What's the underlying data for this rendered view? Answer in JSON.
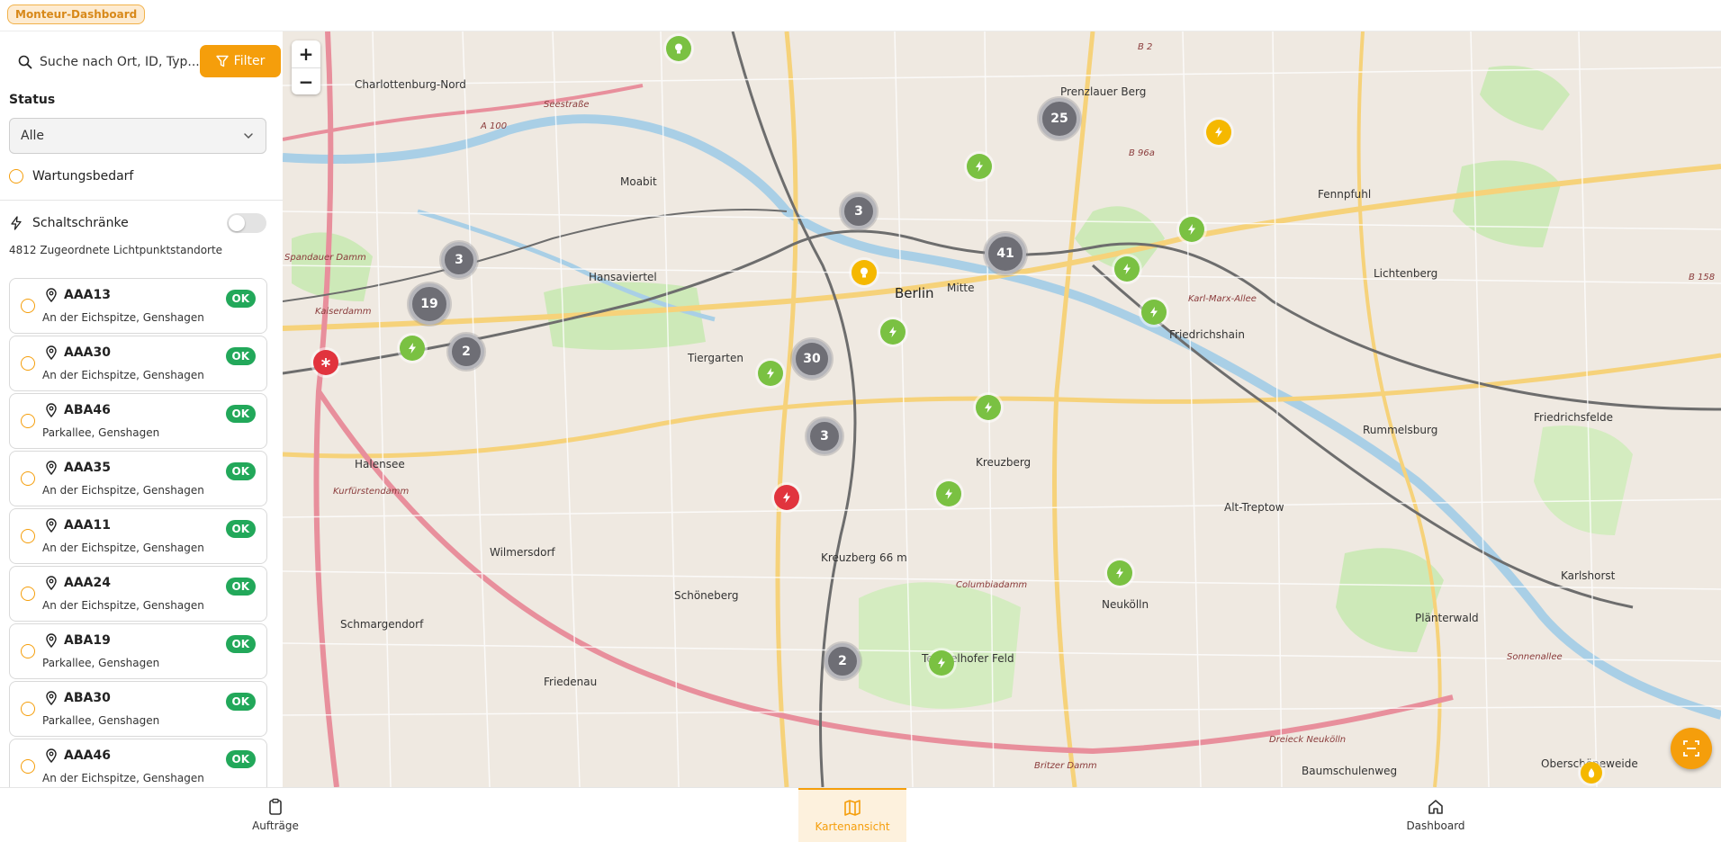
{
  "header": {
    "app_badge": "Monteur-Dashboard"
  },
  "sidebar": {
    "search_placeholder": "Suche nach Ort, ID, Typ...",
    "filter_label": "Filter",
    "status_label": "Status",
    "status_value": "Alle",
    "wartung_label": "Wartungsbedarf",
    "schalt_label": "Schaltschränke",
    "count_text": "4812 Zugeordnete Lichtpunktstandorte",
    "items": [
      {
        "id": "AAA13",
        "address": "An der Eichspitze, Genshagen",
        "status": "OK"
      },
      {
        "id": "AAA30",
        "address": "An der Eichspitze, Genshagen",
        "status": "OK"
      },
      {
        "id": "ABA46",
        "address": "Parkallee, Genshagen",
        "status": "OK"
      },
      {
        "id": "AAA35",
        "address": "An der Eichspitze, Genshagen",
        "status": "OK"
      },
      {
        "id": "AAA11",
        "address": "An der Eichspitze, Genshagen",
        "status": "OK"
      },
      {
        "id": "AAA24",
        "address": "An der Eichspitze, Genshagen",
        "status": "OK"
      },
      {
        "id": "ABA19",
        "address": "Parkallee, Genshagen",
        "status": "OK"
      },
      {
        "id": "ABA30",
        "address": "Parkallee, Genshagen",
        "status": "OK"
      },
      {
        "id": "AAA46",
        "address": "An der Eichspitze, Genshagen",
        "status": "OK"
      }
    ]
  },
  "map": {
    "zoom_in": "+",
    "zoom_out": "−",
    "places": [
      "Charlottenburg-Nord",
      "Moabit",
      "Hansaviertel",
      "Tiergarten",
      "Berlin",
      "Mitte",
      "Prenzlauer Berg",
      "Friedrichshain",
      "Lichtenberg",
      "Fennpfuhl",
      "Kreuzberg",
      "Halensee",
      "Wilmersdorf",
      "Schöneberg",
      "Schmargendorf",
      "Friedenau",
      "Neukölln",
      "Alt-Treptow",
      "Rummelsburg",
      "Friedrichsfelde",
      "Karlshorst",
      "Plänterwald",
      "Baumschulenweg",
      "Oberschöneweide",
      "Tempelhofer Feld",
      "Kreuzberg 66 m"
    ],
    "roads": [
      "A 100",
      "Seestraße",
      "Kaiserdamm",
      "Spandauer Damm",
      "Kurfürstendamm",
      "Sonnenallee",
      "Karl-Marx-Allee",
      "B 96a",
      "B 2",
      "B 158",
      "Columbiadamm",
      "Britzer Damm",
      "Dreieck Neukölln"
    ],
    "clusters": [
      "3",
      "19",
      "2",
      "3",
      "30",
      "3",
      "41",
      "25",
      "2"
    ],
    "colors": {
      "green": "#7ac142",
      "yellow": "#f5b800",
      "red": "#e1343e",
      "cluster": "#6e6e75",
      "accent": "#f59e0b"
    }
  },
  "nav": {
    "orders": "Aufträge",
    "map": "Kartenansicht",
    "dashboard": "Dashboard"
  }
}
